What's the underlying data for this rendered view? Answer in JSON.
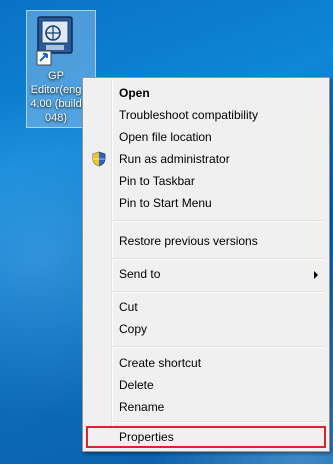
{
  "desktop_icon": {
    "label_lines": [
      "GP",
      "Editor(eng",
      "4.00 (build",
      "048)"
    ]
  },
  "context_menu": {
    "open": "Open",
    "troubleshoot": "Troubleshoot compatibility",
    "open_file_location": "Open file location",
    "run_as_admin": "Run as administrator",
    "pin_taskbar": "Pin to Taskbar",
    "pin_start": "Pin to Start Menu",
    "restore_versions": "Restore previous versions",
    "send_to": "Send to",
    "cut": "Cut",
    "copy": "Copy",
    "create_shortcut": "Create shortcut",
    "delete": "Delete",
    "rename": "Rename",
    "properties": "Properties"
  },
  "colors": {
    "desktop": "#0a72c4",
    "menu_bg": "#f0f0f0",
    "highlight_border": "#d9252e"
  }
}
